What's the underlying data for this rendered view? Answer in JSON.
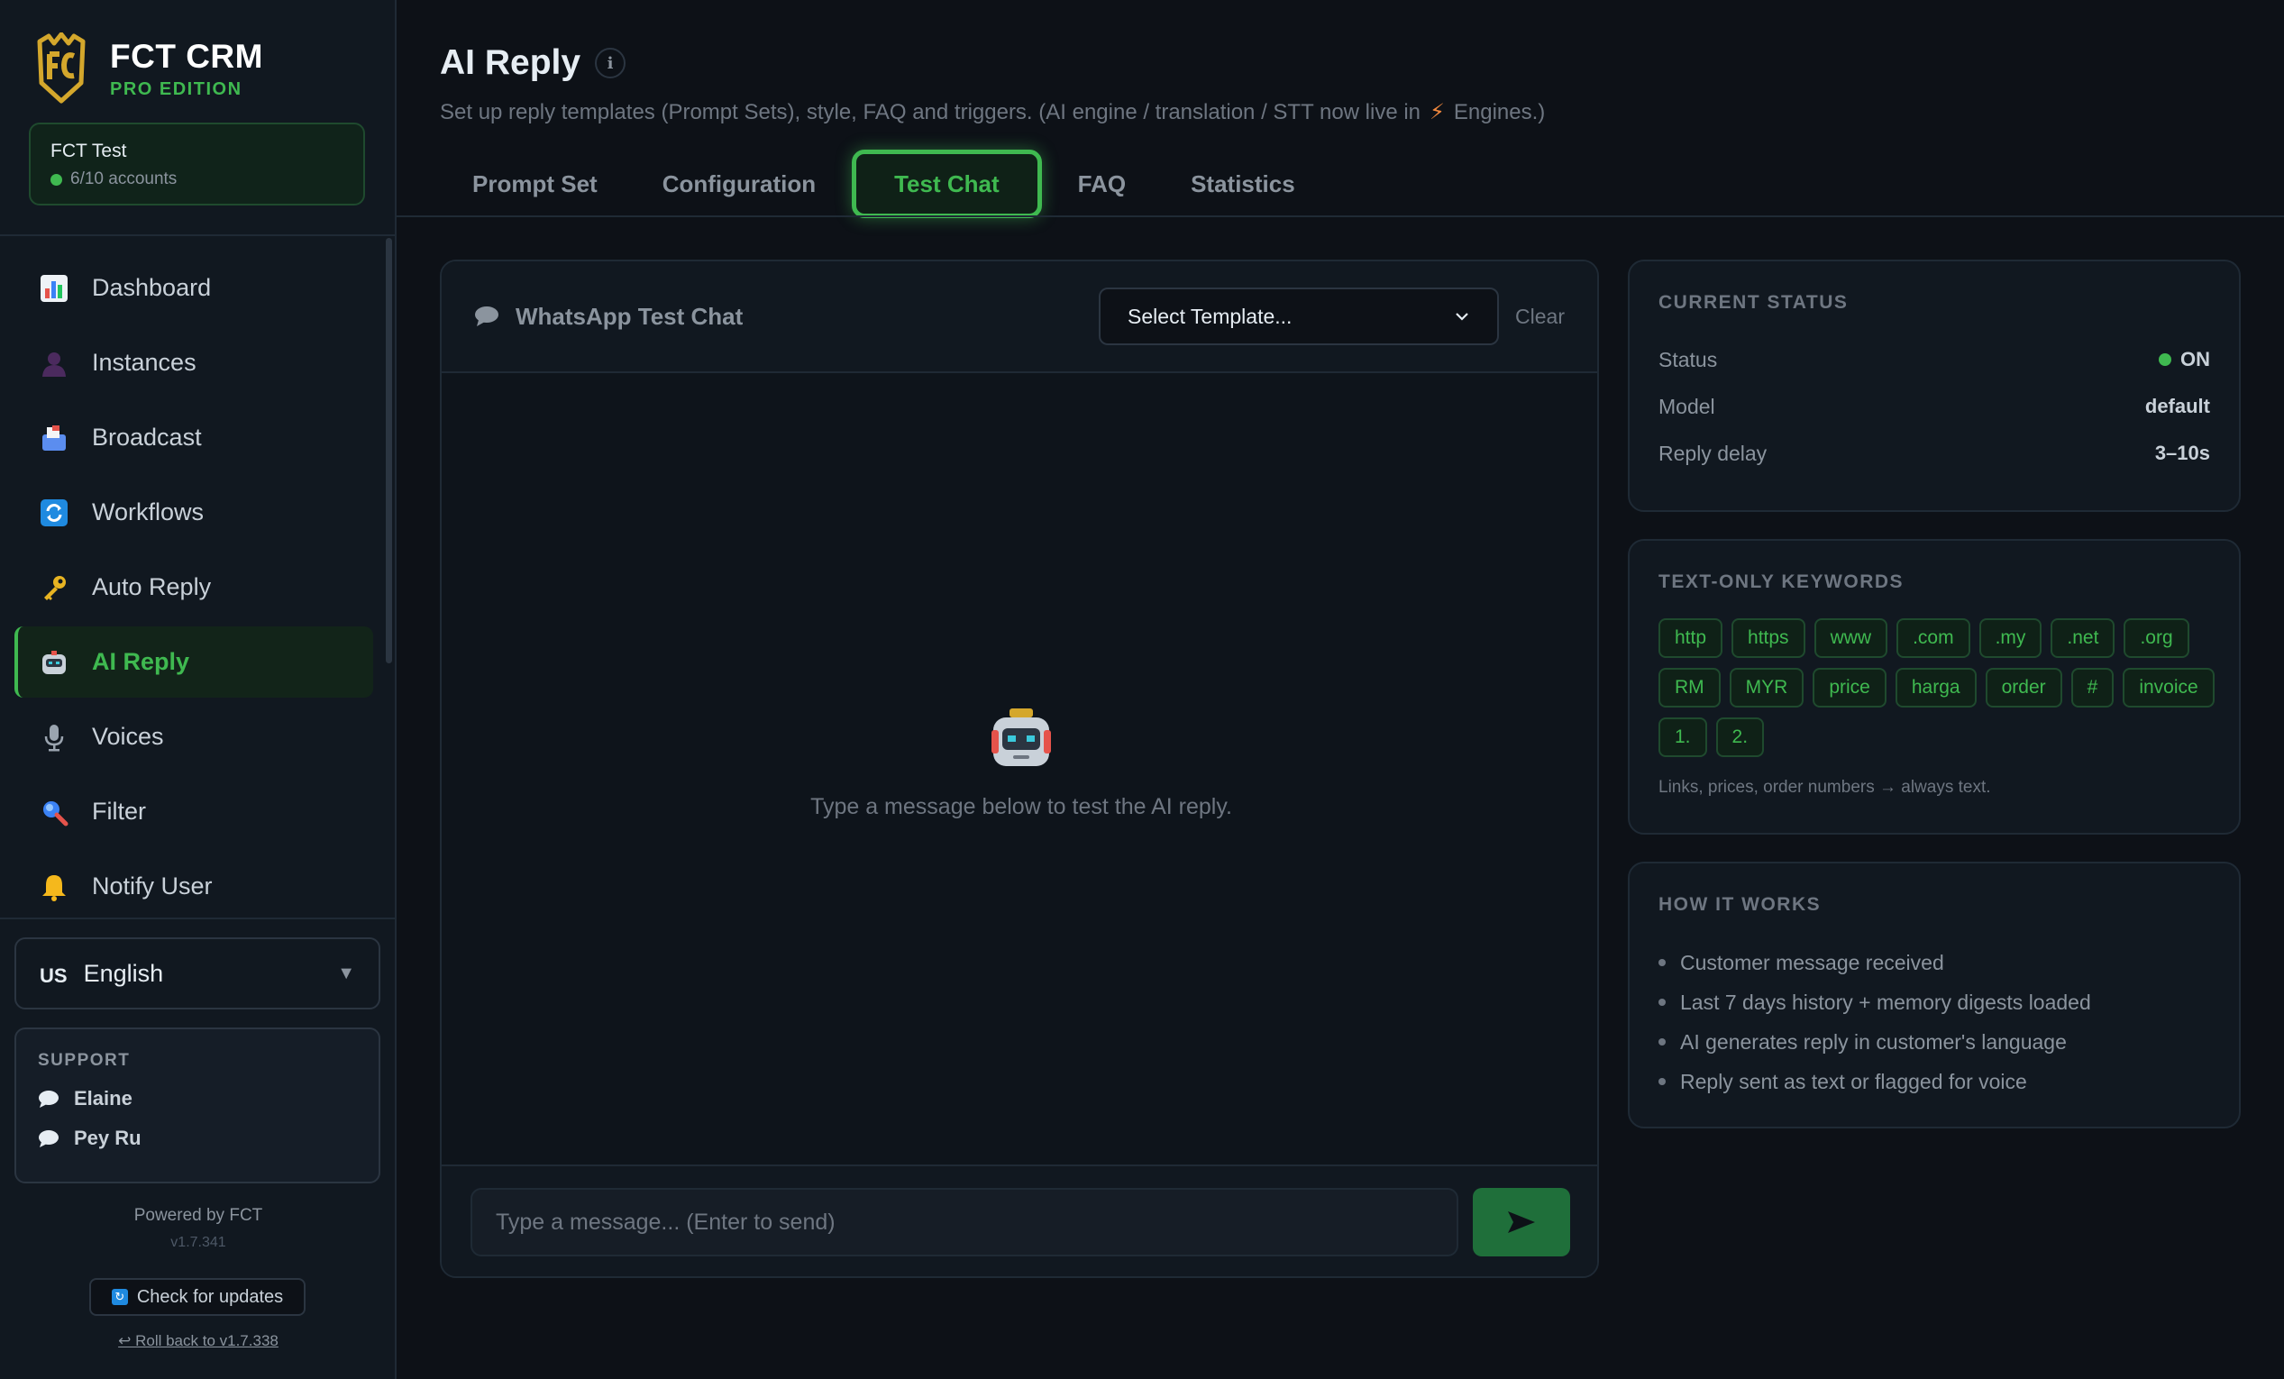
{
  "brand": {
    "title": "FCT CRM",
    "edition": "PRO EDITION"
  },
  "account": {
    "name": "FCT Test",
    "count": "6/10 accounts"
  },
  "nav": {
    "items": [
      {
        "label": "Dashboard",
        "icon": "bar-chart-icon"
      },
      {
        "label": "Instances",
        "icon": "user-silhouette-icon"
      },
      {
        "label": "Broadcast",
        "icon": "mailbox-icon"
      },
      {
        "label": "Workflows",
        "icon": "refresh-icon"
      },
      {
        "label": "Auto Reply",
        "icon": "key-icon"
      },
      {
        "label": "AI Reply",
        "icon": "robot-icon",
        "active": true
      },
      {
        "label": "Voices",
        "icon": "microphone-icon"
      },
      {
        "label": "Filter",
        "icon": "magnifier-icon"
      },
      {
        "label": "Notify User",
        "icon": "bell-icon"
      }
    ]
  },
  "language": {
    "flag": "US",
    "label": "English"
  },
  "support": {
    "title": "SUPPORT",
    "contacts": [
      "Elaine",
      "Pey Ru"
    ]
  },
  "footer": {
    "powered": "Powered by FCT",
    "version": "v1.7.341",
    "update_label": "Check for updates",
    "rollback_label": "↩ Roll back to v1.7.338"
  },
  "page": {
    "title": "AI Reply",
    "subtitle_before": "Set up reply templates (Prompt Sets), style, FAQ and triggers. (AI engine / translation / STT now live in",
    "subtitle_after": "Engines.)"
  },
  "tabs": [
    "Prompt Set",
    "Configuration",
    "Test Chat",
    "FAQ",
    "Statistics"
  ],
  "active_tab": "Test Chat",
  "chat": {
    "title": "WhatsApp Test Chat",
    "template_placeholder": "Select Template...",
    "clear_label": "Clear",
    "empty_text": "Type a message below to test the AI reply.",
    "input_placeholder": "Type a message... (Enter to send)",
    "input_value": ""
  },
  "status_card": {
    "title": "CURRENT STATUS",
    "rows": [
      {
        "key": "Status",
        "value": "ON"
      },
      {
        "key": "Model",
        "value": "default"
      },
      {
        "key": "Reply delay",
        "value": "3–10s"
      }
    ]
  },
  "keywords_card": {
    "title": "TEXT-ONLY KEYWORDS",
    "keywords": [
      "http",
      "https",
      "www",
      ".com",
      ".my",
      ".net",
      ".org",
      "RM",
      "MYR",
      "price",
      "harga",
      "order",
      "#",
      "invoice",
      "1.",
      "2."
    ],
    "note": "Links, prices, order numbers → always text."
  },
  "how_card": {
    "title": "HOW IT WORKS",
    "steps": [
      "Customer message received",
      "Last 7 days history + memory digests loaded",
      "AI generates reply in customer's language",
      "Reply sent as text or flagged for voice"
    ]
  },
  "colors": {
    "accent": "#3fb950",
    "background": "#0d1117",
    "sidebar": "#111820",
    "brand_gold": "#d4a72c"
  }
}
